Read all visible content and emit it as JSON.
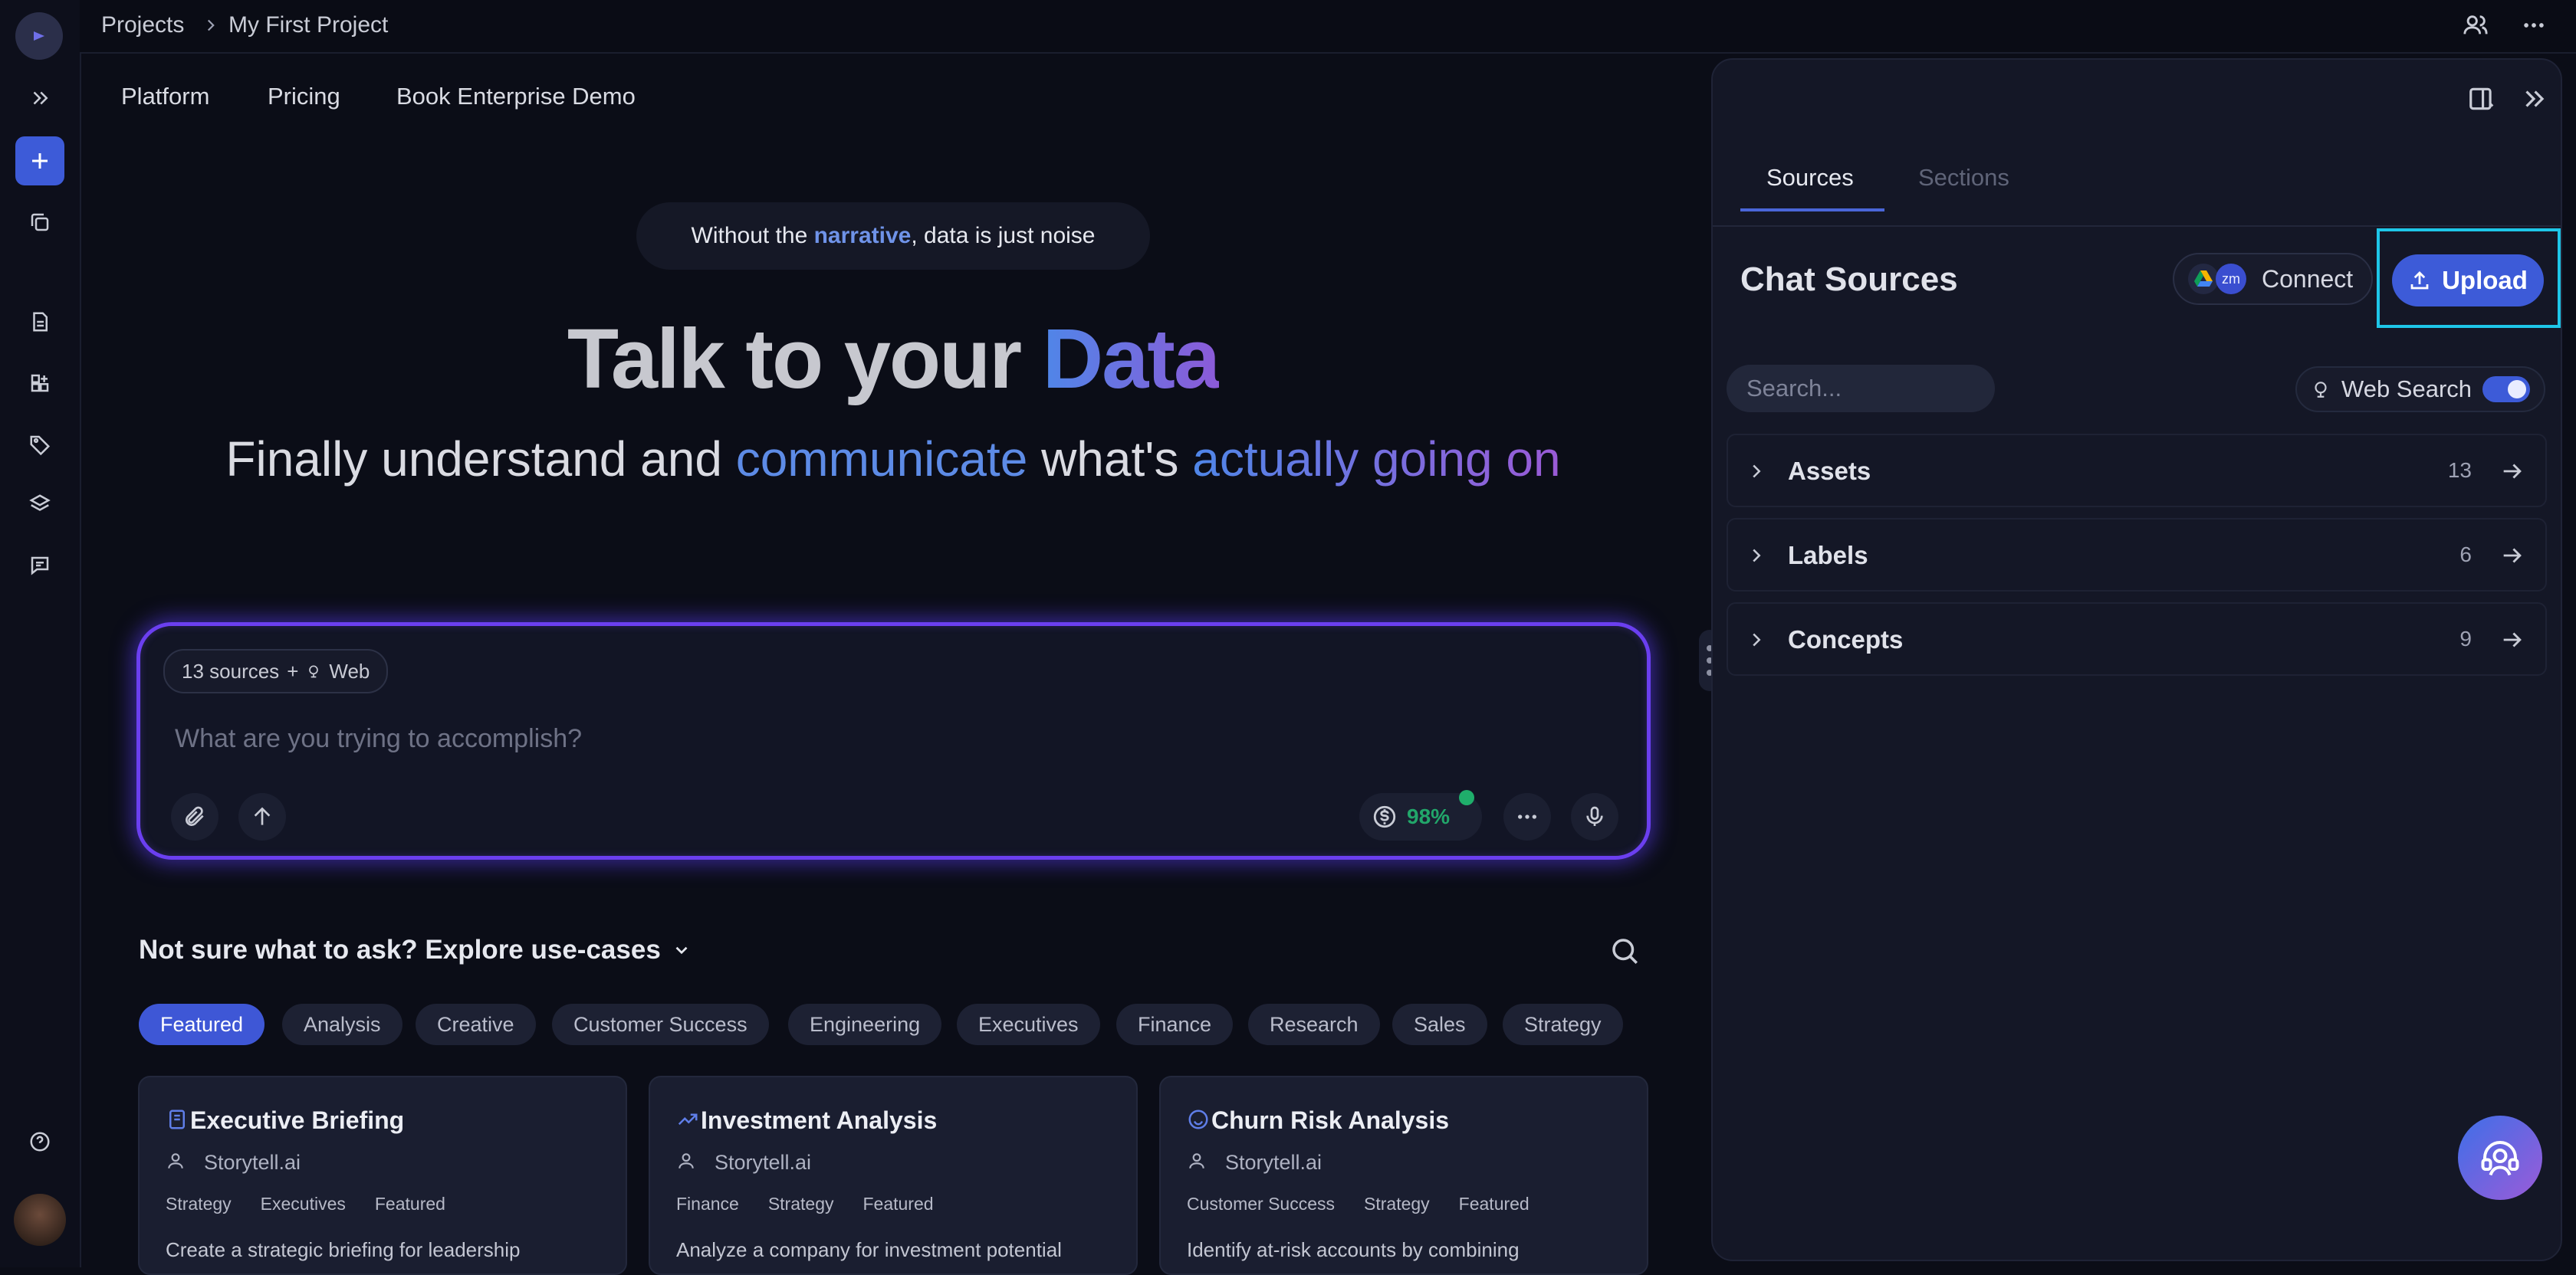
{
  "breadcrumb": {
    "root": "Projects",
    "current": "My First Project"
  },
  "nav": {
    "links": [
      "Platform",
      "Pricing",
      "Book Enterprise Demo"
    ]
  },
  "hero": {
    "pill_before": "Without the ",
    "pill_highlight": "narrative",
    "pill_after": ", data is just noise",
    "headline_plain": "Talk to your ",
    "headline_accent": "Data",
    "sub_1": "Finally understand and ",
    "sub_2": "communicate",
    "sub_3": " what's ",
    "sub_4": "actually going on"
  },
  "chat": {
    "sources_chip": "13 sources",
    "plus": "+",
    "web_label": "Web",
    "placeholder": "What are you trying to accomplish?",
    "credit_percent": "98%"
  },
  "explore": {
    "title": "Not sure what to ask? Explore use-cases",
    "tags": [
      "Featured",
      "Analysis",
      "Creative",
      "Customer Success",
      "Engineering",
      "Executives",
      "Finance",
      "Research",
      "Sales",
      "Strategy"
    ],
    "active_tag": "Featured"
  },
  "cards": [
    {
      "title": "Executive Briefing",
      "author": "Storytell.ai",
      "tags": [
        "Strategy",
        "Executives",
        "Featured"
      ],
      "desc": "Create a strategic briefing for leadership",
      "icon": "document-icon"
    },
    {
      "title": "Investment Analysis",
      "author": "Storytell.ai",
      "tags": [
        "Finance",
        "Strategy",
        "Featured"
      ],
      "desc": "Analyze a company for investment potential",
      "icon": "trend-up-icon"
    },
    {
      "title": "Churn Risk Analysis",
      "author": "Storytell.ai",
      "tags": [
        "Customer Success",
        "Strategy",
        "Featured"
      ],
      "desc": "Identify at-risk accounts by combining",
      "icon": "smiley-icon"
    }
  ],
  "panel": {
    "tabs": [
      "Sources",
      "Sections"
    ],
    "active_tab": "Sources",
    "title": "Chat Sources",
    "connect_label": "Connect",
    "connect_badge": "zm",
    "upload_label": "Upload",
    "search_placeholder": "Search...",
    "web_search_label": "Web Search",
    "web_search_on": true,
    "sections": [
      {
        "label": "Assets",
        "count": "13"
      },
      {
        "label": "Labels",
        "count": "6"
      },
      {
        "label": "Concepts",
        "count": "9"
      }
    ]
  },
  "colors": {
    "accent": "#3d5bd8",
    "success": "#22a66a",
    "highlight_frame": "#1ec6e8"
  }
}
